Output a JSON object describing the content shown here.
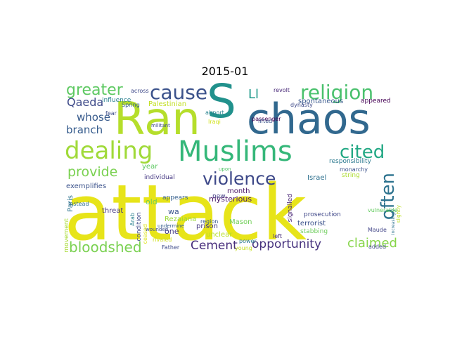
{
  "title": "2015-01",
  "cloud": {
    "words": [
      {
        "text": "attack",
        "color": "#e7e419"
      },
      {
        "text": "S",
        "color": "#21918c"
      },
      {
        "text": "Ran",
        "color": "#b5de2b"
      },
      {
        "text": "chaos",
        "color": "#31688e"
      },
      {
        "text": "Muslims",
        "color": "#35b779"
      },
      {
        "text": "dealing",
        "color": "#a0da39"
      },
      {
        "text": "religion",
        "color": "#4ac16d"
      },
      {
        "text": "cause",
        "color": "#3b528b"
      },
      {
        "text": "greater",
        "color": "#5ec962"
      },
      {
        "text": "violence",
        "color": "#3e4989"
      },
      {
        "text": "cited",
        "color": "#22a884"
      },
      {
        "text": "often",
        "color": "#2c728e"
      },
      {
        "text": "bloodshed",
        "color": "#7ad151"
      },
      {
        "text": "opportunity",
        "color": "#46327e"
      },
      {
        "text": "provide",
        "color": "#7ad151"
      },
      {
        "text": "claimed",
        "color": "#86d549"
      },
      {
        "text": "Cement",
        "color": "#472d7b"
      },
      {
        "text": "Qaeda",
        "color": "#3e4a89"
      },
      {
        "text": "whose",
        "color": "#375a8c"
      },
      {
        "text": "branch",
        "color": "#365c8d"
      },
      {
        "text": "Ll",
        "color": "#1f998a"
      },
      {
        "text": "Palestinian",
        "color": "#c2df23"
      },
      {
        "text": "spontaneous",
        "color": "#38588c"
      },
      {
        "text": "appeared",
        "color": "#440154"
      },
      {
        "text": "responsibility",
        "color": "#2a788e"
      },
      {
        "text": "string",
        "color": "#addc30"
      },
      {
        "text": "Israel",
        "color": "#2d708e"
      },
      {
        "text": "prosecution",
        "color": "#3f4788"
      },
      {
        "text": "terrorist",
        "color": "#3b528b"
      },
      {
        "text": "stabbing",
        "color": "#6ccd5a"
      },
      {
        "text": "signalled",
        "color": "#482475"
      },
      {
        "text": "Mason",
        "color": "#70cf57"
      },
      {
        "text": "prison",
        "color": "#453781"
      },
      {
        "text": "new",
        "color": "#433e85"
      },
      {
        "text": "mysterious",
        "color": "#48186a"
      },
      {
        "text": "month",
        "color": "#471365"
      },
      {
        "text": "wa",
        "color": "#3a548c"
      },
      {
        "text": "one",
        "color": "#443983"
      },
      {
        "text": "old",
        "color": "#6ece58"
      },
      {
        "text": "individual",
        "color": "#453882"
      },
      {
        "text": "year",
        "color": "#5ec962"
      },
      {
        "text": "exemplifies",
        "color": "#3b528b"
      },
      {
        "text": "Paris",
        "color": "#2c728e"
      },
      {
        "text": "Arab",
        "color": "#277f8e"
      },
      {
        "text": "condition",
        "color": "#3f4889"
      },
      {
        "text": "Rezaiana",
        "color": "#9bd93c"
      },
      {
        "text": "unclear",
        "color": "#b8de29"
      },
      {
        "text": "appears",
        "color": "#355f8d"
      },
      {
        "text": "region",
        "color": "#39568c"
      },
      {
        "text": "threat",
        "color": "#453781"
      },
      {
        "text": "movement",
        "color": "#a8db34"
      },
      {
        "text": "instead",
        "color": "#2e6e8e"
      },
      {
        "text": "ceased",
        "color": "#dde318"
      },
      {
        "text": "wounded",
        "color": "#3c4f8a"
      },
      {
        "text": "rivaled",
        "color": "#d0e11c"
      },
      {
        "text": "Father",
        "color": "#3e4a89"
      },
      {
        "text": "power",
        "color": "#2a788e"
      },
      {
        "text": "young",
        "color": "#c8e020"
      },
      {
        "text": "left",
        "color": "#472c7a"
      },
      {
        "text": "Maude",
        "color": "#414487"
      },
      {
        "text": "added",
        "color": "#3f4788"
      },
      {
        "text": "slightly",
        "color": "#bddf26"
      },
      {
        "text": "increasingly",
        "color": "#2c728e"
      },
      {
        "text": "vulnerable",
        "color": "#63cb5f"
      },
      {
        "text": "passenger",
        "color": "#440154"
      },
      {
        "text": "undermine",
        "color": "#355e8d"
      },
      {
        "text": "Iraqi",
        "color": "#d2e21b"
      },
      {
        "text": "militant",
        "color": "#3e4989"
      },
      {
        "text": "lifted",
        "color": "#3a548c"
      },
      {
        "text": "dynasty",
        "color": "#3e4a89"
      },
      {
        "text": "monarchy",
        "color": "#3b528b"
      },
      {
        "text": "airport",
        "color": "#26828e"
      },
      {
        "text": "revolt",
        "color": "#482878"
      },
      {
        "text": "across",
        "color": "#3e4989"
      },
      {
        "text": "influence",
        "color": "#277f8e"
      },
      {
        "text": "Spring",
        "color": "#355f8d"
      },
      {
        "text": "fear",
        "color": "#3d4e8a"
      },
      {
        "text": "upon",
        "color": "#52c569"
      }
    ]
  }
}
